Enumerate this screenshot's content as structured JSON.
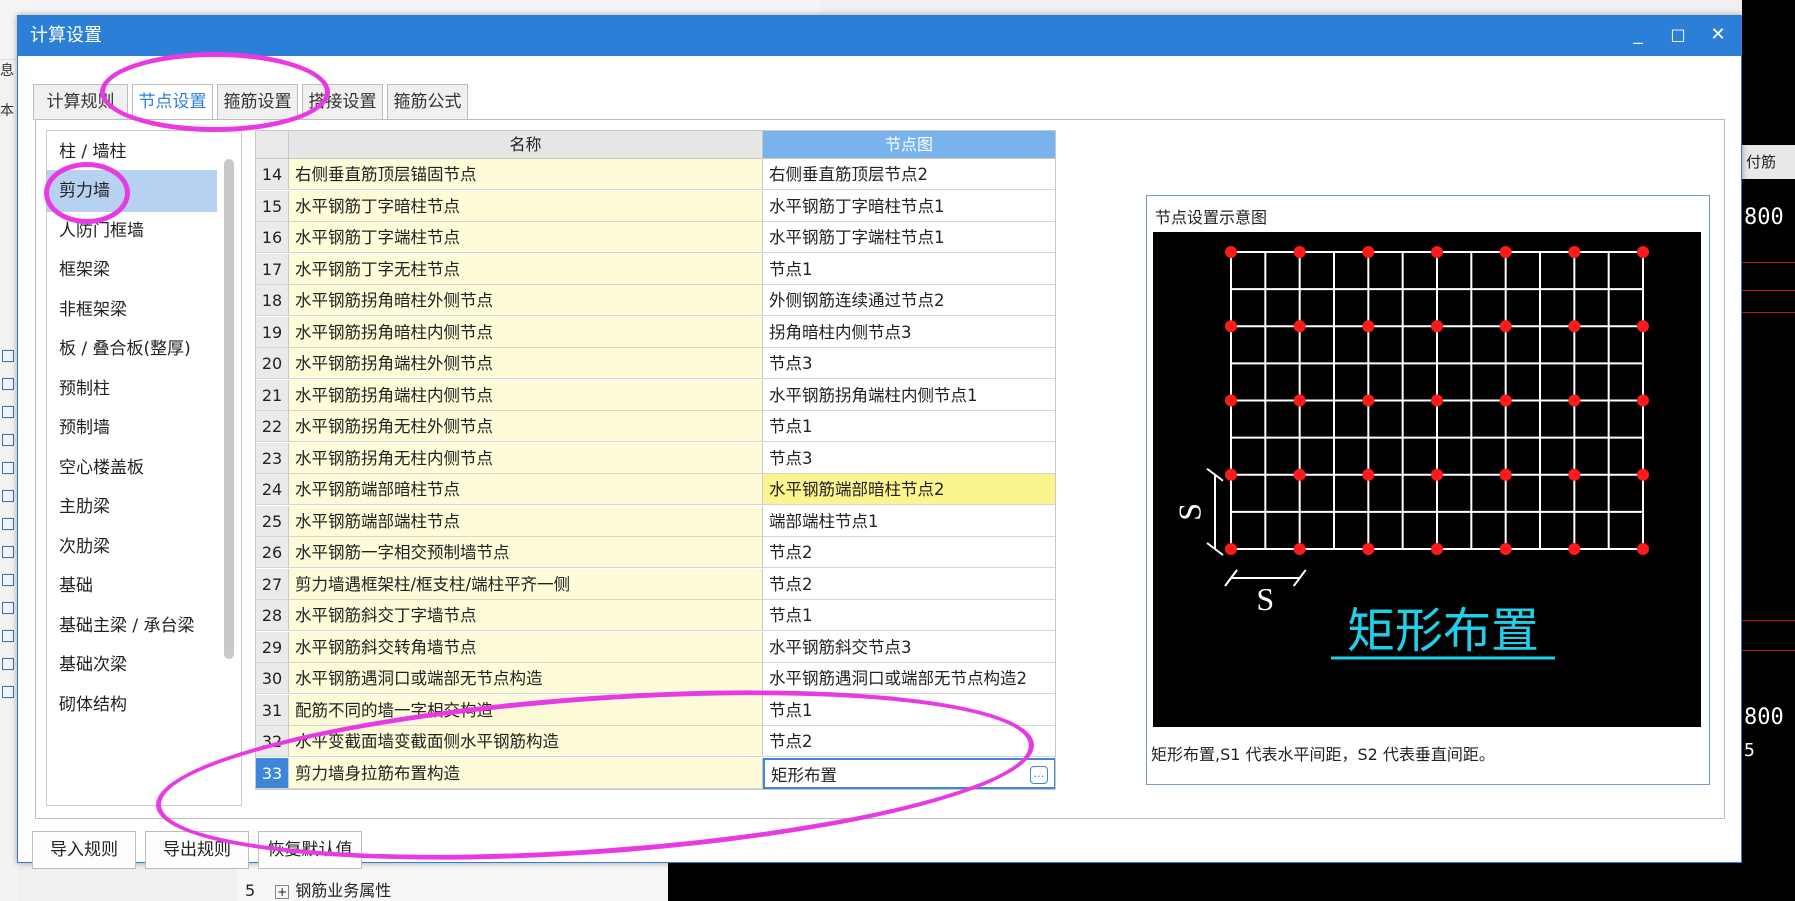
{
  "dialog": {
    "title": "计算设置",
    "minimize": "_",
    "maximize": "□",
    "close": "✕"
  },
  "tabs": [
    {
      "label": "计算规则",
      "active": false
    },
    {
      "label": "节点设置",
      "active": true
    },
    {
      "label": "箍筋设置",
      "active": false
    },
    {
      "label": "搭接设置",
      "active": false
    },
    {
      "label": "箍筋公式",
      "active": false
    }
  ],
  "categories": [
    {
      "label": "柱 / 墙柱",
      "selected": false
    },
    {
      "label": "剪力墙",
      "selected": true
    },
    {
      "label": "人防门框墙",
      "selected": false
    },
    {
      "label": "框架梁",
      "selected": false
    },
    {
      "label": "非框架梁",
      "selected": false
    },
    {
      "label": "板 / 叠合板(整厚)",
      "selected": false
    },
    {
      "label": "预制柱",
      "selected": false
    },
    {
      "label": "预制墙",
      "selected": false
    },
    {
      "label": "空心楼盖板",
      "selected": false
    },
    {
      "label": "主肋梁",
      "selected": false
    },
    {
      "label": "次肋梁",
      "selected": false
    },
    {
      "label": "基础",
      "selected": false
    },
    {
      "label": "基础主梁 / 承台梁",
      "selected": false
    },
    {
      "label": "基础次梁",
      "selected": false
    },
    {
      "label": "砌体结构",
      "selected": false
    }
  ],
  "table": {
    "headers": {
      "name": "名称",
      "node": "节点图"
    },
    "rows": [
      {
        "num": "14",
        "name": "右侧垂直筋顶层锚固节点",
        "node": "右侧垂直筋顶层节点2"
      },
      {
        "num": "15",
        "name": "水平钢筋丁字暗柱节点",
        "node": "水平钢筋丁字暗柱节点1"
      },
      {
        "num": "16",
        "name": "水平钢筋丁字端柱节点",
        "node": "水平钢筋丁字端柱节点1"
      },
      {
        "num": "17",
        "name": "水平钢筋丁字无柱节点",
        "node": "节点1"
      },
      {
        "num": "18",
        "name": "水平钢筋拐角暗柱外侧节点",
        "node": "外侧钢筋连续通过节点2"
      },
      {
        "num": "19",
        "name": "水平钢筋拐角暗柱内侧节点",
        "node": "拐角暗柱内侧节点3"
      },
      {
        "num": "20",
        "name": "水平钢筋拐角端柱外侧节点",
        "node": "节点3"
      },
      {
        "num": "21",
        "name": "水平钢筋拐角端柱内侧节点",
        "node": "水平钢筋拐角端柱内侧节点1"
      },
      {
        "num": "22",
        "name": "水平钢筋拐角无柱外侧节点",
        "node": "节点1"
      },
      {
        "num": "23",
        "name": "水平钢筋拐角无柱内侧节点",
        "node": "节点3"
      },
      {
        "num": "24",
        "name": "水平钢筋端部暗柱节点",
        "node": "水平钢筋端部暗柱节点2",
        "highlight": true
      },
      {
        "num": "25",
        "name": "水平钢筋端部端柱节点",
        "node": "端部端柱节点1"
      },
      {
        "num": "26",
        "name": "水平钢筋一字相交预制墙节点",
        "node": "节点2"
      },
      {
        "num": "27",
        "name": "剪力墙遇框架柱/框支柱/端柱平齐一侧",
        "node": "节点2"
      },
      {
        "num": "28",
        "name": "水平钢筋斜交丁字墙节点",
        "node": "节点1"
      },
      {
        "num": "29",
        "name": "水平钢筋斜交转角墙节点",
        "node": "水平钢筋斜交节点3"
      },
      {
        "num": "30",
        "name": "水平钢筋遇洞口或端部无节点构造",
        "node": "水平钢筋遇洞口或端部无节点构造2"
      },
      {
        "num": "31",
        "name": "配筋不同的墙一字相交构造",
        "node": "节点1"
      },
      {
        "num": "32",
        "name": "水平变截面墙变截面侧水平钢筋构造",
        "node": "节点2"
      },
      {
        "num": "33",
        "name": "剪力墙身拉筋布置构造",
        "node": "矩形布置",
        "selected": true
      }
    ]
  },
  "preview": {
    "title": "节点设置示意图",
    "diagram_label": "矩形布置",
    "dim_label": "S",
    "description": "矩形布置,S1 代表水平间距，S2 代表垂直间距。"
  },
  "buttons": {
    "import": "导入规则",
    "export": "导出规则",
    "restore": "恢复默认值"
  },
  "background": {
    "right_header": "付筋",
    "right_value": "800",
    "right_value_2": "800",
    "right_digit": "5",
    "tree_row_num": "5",
    "tree_row_label": "钢筋业务属性",
    "left_chars": [
      "息",
      "本"
    ]
  },
  "colors": {
    "titlebar": "#2b7fd6",
    "name_cell": "#fdfbd8",
    "highlight_cell": "#fbf48f",
    "annotation": "#e83ae3",
    "dot": "#ff1a1a",
    "diagram_text": "#1fd0e8"
  }
}
